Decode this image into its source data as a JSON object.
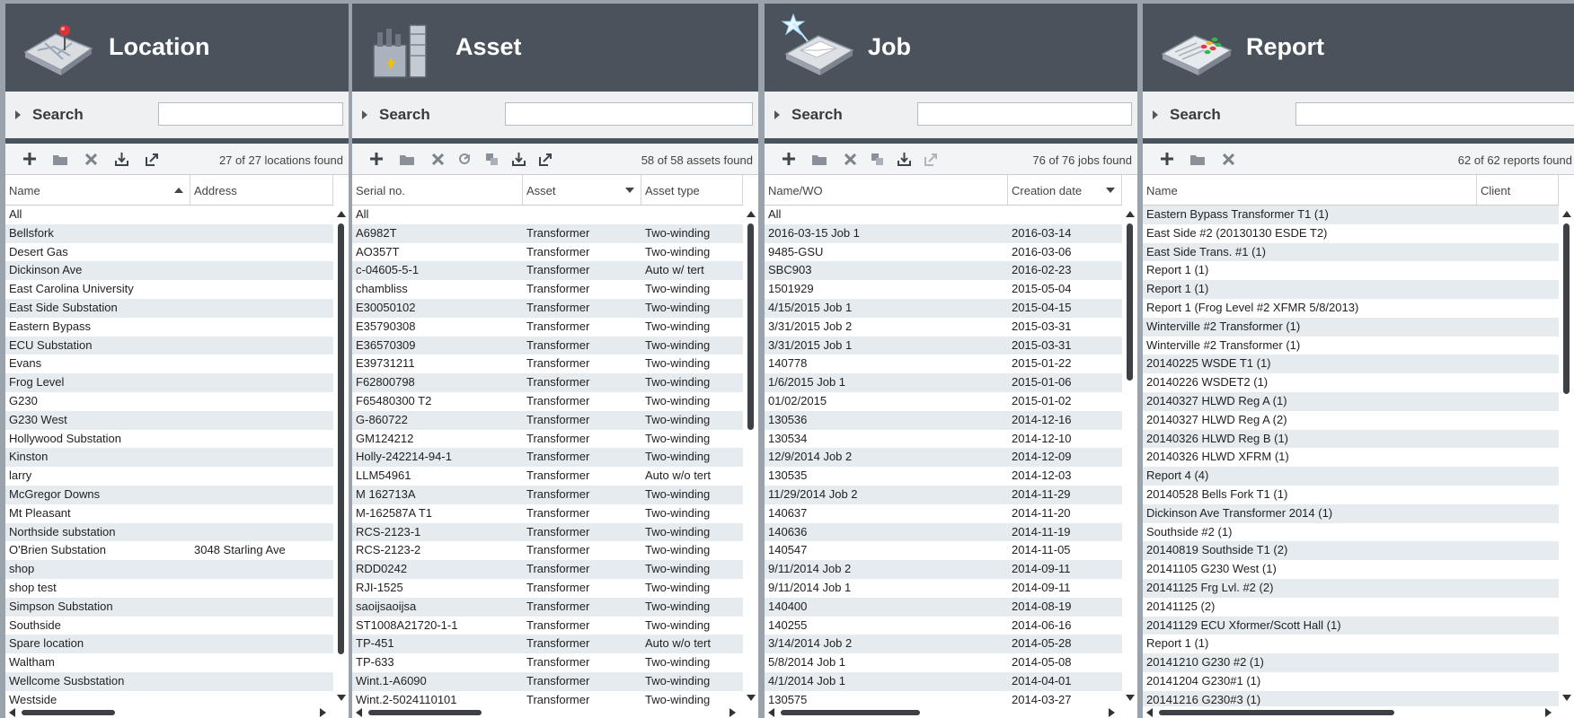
{
  "colors": {
    "header_bg": "#4a525b",
    "row_alt": "#e6ebf0",
    "icon_dark": "#3f454c"
  },
  "panels": [
    {
      "title": "Location",
      "search_label": "Search",
      "search_placeholder": "",
      "count_text": "27 of 27 locations found",
      "toolbar_icons": [
        "plus-icon",
        "folder-icon",
        "delete-x-icon",
        "import-icon",
        "export-icon"
      ],
      "columns": [
        {
          "label": "Name",
          "sort": "asc"
        },
        {
          "label": "Address",
          "sort": ""
        }
      ],
      "rows": [
        [
          "All",
          ""
        ],
        [
          "Bellsfork",
          ""
        ],
        [
          "Desert Gas",
          ""
        ],
        [
          "Dickinson Ave",
          ""
        ],
        [
          "East Carolina University",
          ""
        ],
        [
          "East Side Substation",
          ""
        ],
        [
          "Eastern Bypass",
          ""
        ],
        [
          "ECU Substation",
          ""
        ],
        [
          "Evans",
          ""
        ],
        [
          "Frog Level",
          ""
        ],
        [
          "G230",
          ""
        ],
        [
          "G230 West",
          ""
        ],
        [
          "Hollywood Substation",
          ""
        ],
        [
          "Kinston",
          ""
        ],
        [
          "larry",
          ""
        ],
        [
          "McGregor Downs",
          ""
        ],
        [
          "Mt Pleasant",
          ""
        ],
        [
          "Northside substation",
          ""
        ],
        [
          "O'Brien Substation",
          "3048 Starling Ave"
        ],
        [
          "shop",
          ""
        ],
        [
          "shop test",
          ""
        ],
        [
          "Simpson Substation",
          ""
        ],
        [
          "Southside",
          ""
        ],
        [
          "Spare location",
          ""
        ],
        [
          "Waltham",
          ""
        ],
        [
          "Wellcome Susbstation",
          ""
        ],
        [
          "Westside",
          ""
        ]
      ]
    },
    {
      "title": "Asset",
      "search_label": "Search",
      "search_placeholder": "",
      "count_text": "58 of 58 assets found",
      "toolbar_icons": [
        "plus-icon",
        "folder-icon",
        "delete-x-icon",
        "copy-icon",
        "duplicate-icon",
        "import-icon",
        "export-icon"
      ],
      "columns": [
        {
          "label": "Serial no.",
          "sort": ""
        },
        {
          "label": "Asset",
          "sort": "desc"
        },
        {
          "label": "Asset type",
          "sort": ""
        }
      ],
      "rows": [
        [
          "All",
          "",
          ""
        ],
        [
          "A6982T",
          "Transformer",
          "Two-winding"
        ],
        [
          "AO357T",
          "Transformer",
          "Two-winding"
        ],
        [
          "c-04605-5-1",
          "Transformer",
          "Auto w/ tert"
        ],
        [
          "chambliss",
          "Transformer",
          "Two-winding"
        ],
        [
          "E30050102",
          "Transformer",
          "Two-winding"
        ],
        [
          "E35790308",
          "Transformer",
          "Two-winding"
        ],
        [
          "E36570309",
          "Transformer",
          "Two-winding"
        ],
        [
          "E39731211",
          "Transformer",
          "Two-winding"
        ],
        [
          "F62800798",
          "Transformer",
          "Two-winding"
        ],
        [
          "F65480300 T2",
          "Transformer",
          "Two-winding"
        ],
        [
          "G-860722",
          "Transformer",
          "Two-winding"
        ],
        [
          "GM124212",
          "Transformer",
          "Two-winding"
        ],
        [
          "Holly-242214-94-1",
          "Transformer",
          "Two-winding"
        ],
        [
          "LLM54961",
          "Transformer",
          "Auto w/o tert"
        ],
        [
          "M 162713A",
          "Transformer",
          "Two-winding"
        ],
        [
          "M-162587A T1",
          "Transformer",
          "Two-winding"
        ],
        [
          "RCS-2123-1",
          "Transformer",
          "Two-winding"
        ],
        [
          "RCS-2123-2",
          "Transformer",
          "Two-winding"
        ],
        [
          "RDD0242",
          "Transformer",
          "Two-winding"
        ],
        [
          "RJI-1525",
          "Transformer",
          "Two-winding"
        ],
        [
          "saoijsaoijsa",
          "Transformer",
          "Two-winding"
        ],
        [
          "ST1008A21720-1-1",
          "Transformer",
          "Two-winding"
        ],
        [
          "TP-451",
          "Transformer",
          "Auto w/o tert"
        ],
        [
          "TP-633",
          "Transformer",
          "Two-winding"
        ],
        [
          "Wint.1-A6090",
          "Transformer",
          "Two-winding"
        ],
        [
          "Wint.2-5024110101",
          "Transformer",
          "Two-winding"
        ]
      ]
    },
    {
      "title": "Job",
      "search_label": "Search",
      "search_placeholder": "",
      "count_text": "76 of 76 jobs found",
      "toolbar_icons": [
        "plus-icon",
        "folder-icon",
        "delete-x-icon",
        "duplicate-icon",
        "import-icon",
        "export-icon"
      ],
      "columns": [
        {
          "label": "Name/WO",
          "sort": ""
        },
        {
          "label": "Creation date",
          "sort": "desc"
        }
      ],
      "rows": [
        [
          "All",
          ""
        ],
        [
          "2016-03-15 Job 1",
          "2016-03-14"
        ],
        [
          "9485-GSU",
          "2016-03-06"
        ],
        [
          "SBC903",
          "2016-02-23"
        ],
        [
          "1501929",
          "2015-05-04"
        ],
        [
          "4/15/2015 Job 1",
          "2015-04-15"
        ],
        [
          "3/31/2015 Job 2",
          "2015-03-31"
        ],
        [
          "3/31/2015 Job 1",
          "2015-03-31"
        ],
        [
          "140778",
          "2015-01-22"
        ],
        [
          "1/6/2015 Job 1",
          "2015-01-06"
        ],
        [
          "01/02/2015",
          "2015-01-02"
        ],
        [
          "130536",
          "2014-12-16"
        ],
        [
          "130534",
          "2014-12-10"
        ],
        [
          "12/9/2014 Job 2",
          "2014-12-09"
        ],
        [
          "130535",
          "2014-12-03"
        ],
        [
          "11/29/2014 Job 2",
          "2014-11-29"
        ],
        [
          "140637",
          "2014-11-20"
        ],
        [
          "140636",
          "2014-11-19"
        ],
        [
          "140547",
          "2014-11-05"
        ],
        [
          "9/11/2014 Job 2",
          "2014-09-11"
        ],
        [
          "9/11/2014 Job 1",
          "2014-09-11"
        ],
        [
          "140400",
          "2014-08-19"
        ],
        [
          "140255",
          "2014-06-16"
        ],
        [
          "3/14/2014 Job 2",
          "2014-05-28"
        ],
        [
          "5/8/2014 Job 1",
          "2014-05-08"
        ],
        [
          "4/1/2014 Job 1",
          "2014-04-01"
        ],
        [
          "130575",
          "2014-03-27"
        ]
      ]
    },
    {
      "title": "Report",
      "search_label": "Search",
      "search_placeholder": "",
      "count_text": "62 of 62 reports found",
      "toolbar_icons": [
        "plus-icon",
        "folder-icon",
        "delete-x-icon"
      ],
      "columns": [
        {
          "label": "Name",
          "sort": ""
        },
        {
          "label": "Client",
          "sort": ""
        }
      ],
      "rows": [
        [
          "Eastern Bypass Transformer T1 (1)",
          ""
        ],
        [
          "East Side #2  (20130130 ESDE T2)",
          ""
        ],
        [
          "East Side Trans. #1 (1)",
          ""
        ],
        [
          "Report 1 (1)",
          ""
        ],
        [
          "Report 1 (1)",
          ""
        ],
        [
          "Report 1 (Frog Level #2 XFMR 5/8/2013)",
          ""
        ],
        [
          "Winterville #2 Transformer (1)",
          ""
        ],
        [
          "Winterville #2 Transformer (1)",
          ""
        ],
        [
          "20140225 WSDE T1 (1)",
          ""
        ],
        [
          "20140226 WSDET2 (1)",
          ""
        ],
        [
          "20140327 HLWD Reg A (1)",
          ""
        ],
        [
          "20140327 HLWD Reg A (2)",
          ""
        ],
        [
          "20140326 HLWD Reg B (1)",
          ""
        ],
        [
          "20140326 HLWD XFRM (1)",
          ""
        ],
        [
          "Report 4 (4)",
          ""
        ],
        [
          "20140528 Bells Fork T1 (1)",
          ""
        ],
        [
          "Dickinson Ave Transformer 2014 (1)",
          ""
        ],
        [
          "Southside #2 (1)",
          ""
        ],
        [
          "20140819 Southside T1 (2)",
          ""
        ],
        [
          "20141105 G230 West (1)",
          ""
        ],
        [
          "20141125 Frg Lvl. #2 (2)",
          ""
        ],
        [
          "20141125 (2)",
          ""
        ],
        [
          "20141129 ECU Xformer/Scott Hall (1)",
          ""
        ],
        [
          "Report 1 (1)",
          ""
        ],
        [
          "20141210 G230 #2 (1)",
          ""
        ],
        [
          "20141204 G230#1 (1)",
          ""
        ],
        [
          "20141216 G230#3 (1)",
          ""
        ]
      ]
    }
  ]
}
